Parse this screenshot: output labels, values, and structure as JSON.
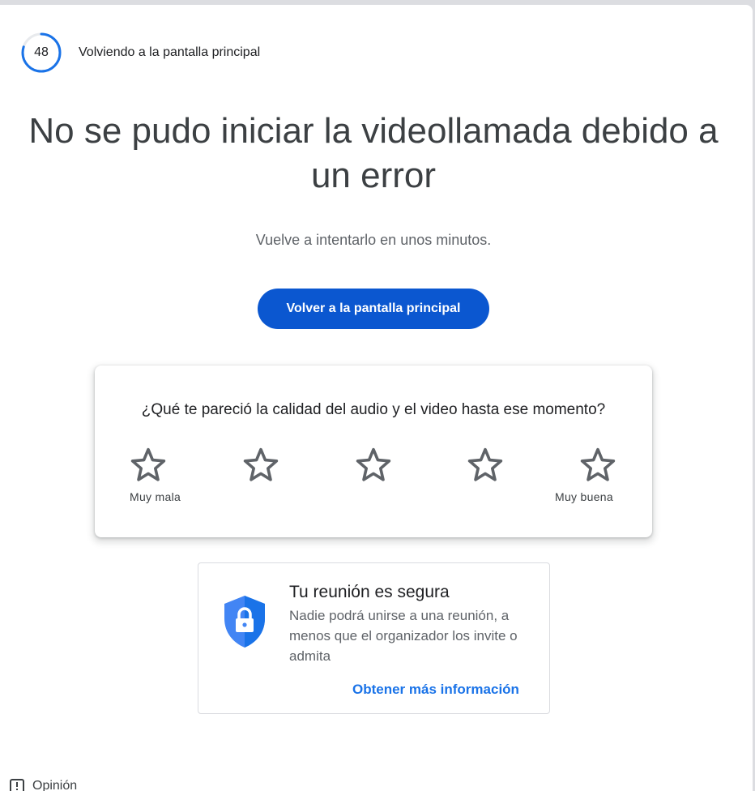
{
  "countdown": {
    "seconds": "48",
    "label": "Volviendo a la pantalla principal",
    "progress": 0.8,
    "color": "#1a73e8"
  },
  "error": {
    "headline_line1": "No se pudo iniciar la videollamada debido a",
    "headline_line2": "un error",
    "subtitle": "Vuelve a intentarlo en unos minutos."
  },
  "primary_button": {
    "label": "Volver a la pantalla principal",
    "color": "#0b57d0"
  },
  "rating": {
    "question": "¿Qué te pareció la calidad del audio y el video hasta ese momento?",
    "stars": [
      {
        "icon": "star-outline-icon"
      },
      {
        "icon": "star-outline-icon"
      },
      {
        "icon": "star-outline-icon"
      },
      {
        "icon": "star-outline-icon"
      },
      {
        "icon": "star-outline-icon"
      }
    ],
    "low_label": "Muy mala",
    "high_label": "Muy buena"
  },
  "secure": {
    "icon": "shield-lock-icon",
    "title": "Tu reunión es segura",
    "description": "Nadie podrá unirse a una reunión, a menos que el organizador los invite o admita",
    "link": "Obtener más información",
    "shield_color": "#4285f4"
  },
  "feedback": {
    "icon": "feedback-icon",
    "label": "Opinión"
  }
}
